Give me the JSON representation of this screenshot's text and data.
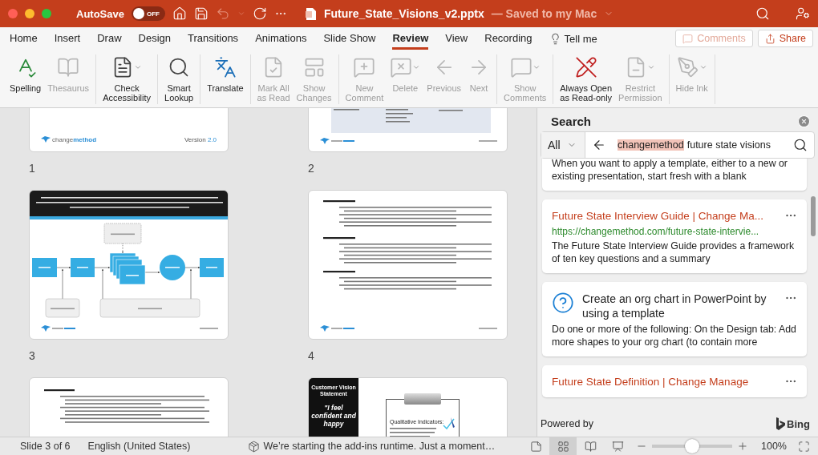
{
  "titlebar": {
    "autosave_label": "AutoSave",
    "autosave": {
      "on": false,
      "label": "OFF"
    },
    "undo": {
      "disabled": true
    },
    "filename": "Future_State_Visions_v2.pptx",
    "save_status": "— Saved to my Mac"
  },
  "tabs": [
    {
      "label": "Home",
      "selected": false
    },
    {
      "label": "Insert",
      "selected": false
    },
    {
      "label": "Draw",
      "selected": false
    },
    {
      "label": "Design",
      "selected": false
    },
    {
      "label": "Transitions",
      "selected": false
    },
    {
      "label": "Animations",
      "selected": false
    },
    {
      "label": "Slide Show",
      "selected": false
    },
    {
      "label": "Review",
      "selected": true
    },
    {
      "label": "View",
      "selected": false
    },
    {
      "label": "Recording",
      "selected": false
    }
  ],
  "tell_me": "Tell me",
  "comments_button": {
    "label": "Comments",
    "disabled": true
  },
  "share_button": {
    "label": "Share"
  },
  "ribbon": {
    "groups": [
      [
        {
          "label": "Spelling",
          "disabled": false,
          "dropdown": false
        },
        {
          "label": "Thesaurus",
          "disabled": true,
          "dropdown": false
        }
      ],
      [
        {
          "label": "Check\nAccessibility",
          "disabled": false,
          "dropdown": true
        }
      ],
      [
        {
          "label": "Smart\nLookup",
          "disabled": false,
          "dropdown": false
        }
      ],
      [
        {
          "label": "Translate",
          "disabled": false,
          "dropdown": false
        }
      ],
      [
        {
          "label": "Mark All\nas Read",
          "disabled": true,
          "dropdown": false
        },
        {
          "label": "Show\nChanges",
          "disabled": true,
          "dropdown": false
        }
      ],
      [
        {
          "label": "New\nComment",
          "disabled": true,
          "dropdown": false
        },
        {
          "label": "Delete",
          "disabled": true,
          "dropdown": true
        },
        {
          "label": "Previous",
          "disabled": true,
          "dropdown": false
        },
        {
          "label": "Next",
          "disabled": true,
          "dropdown": false
        }
      ],
      [
        {
          "label": "Show\nComments",
          "disabled": true,
          "dropdown": true
        }
      ],
      [
        {
          "label": "Always Open\nas Read-only",
          "disabled": false,
          "dropdown": false
        },
        {
          "label": "Restrict\nPermission",
          "disabled": true,
          "dropdown": true
        }
      ],
      [
        {
          "label": "Hide Ink",
          "disabled": true,
          "dropdown": true
        }
      ]
    ]
  },
  "slides": [
    {
      "number": "1",
      "kind": "closing",
      "logo": "change**method**",
      "version": "Version **2.0**"
    },
    {
      "number": "2",
      "kind": "table"
    },
    {
      "number": "3",
      "kind": "diagram",
      "nodes": [
        {
          "kind": "dashed"
        },
        {
          "kind": "box"
        },
        {
          "kind": "box"
        },
        {
          "kind": "stack"
        },
        {
          "kind": "circle"
        },
        {
          "kind": "box"
        },
        {
          "kind": "rounded"
        },
        {
          "kind": "rounded"
        }
      ]
    },
    {
      "number": "4",
      "kind": "steps"
    },
    {
      "kind": "steps"
    },
    {
      "kind": "vision",
      "panel_title": "Customer Vision Statement",
      "quote": "\"I feel confident and happy",
      "board_title": "Qualitative Indicators:"
    }
  ],
  "search": {
    "title": "Search",
    "scope": "All",
    "query": [
      {
        "text": "changemethod",
        "highlighted": true
      },
      {
        "text": "future state visions",
        "highlighted": false
      }
    ],
    "results": [
      {
        "description": "When you want to apply a template, either to a new or existing presentation, start fresh with a blank"
      },
      {
        "kind": "web",
        "title": "Future State Interview Guide | Change Ma...",
        "url": "https://changemethod.com/future-state-intervie...",
        "description": "The Future State Interview Guide provides a framework of ten key questions and a summary"
      },
      {
        "kind": "help",
        "title": "Create an org chart in PowerPoint by using a template",
        "description": "Do one or more of the following: On the Design tab: Add more shapes to your org chart (to contain more"
      },
      {
        "kind": "web",
        "title": "Future State Definition | Change Manage"
      }
    ],
    "powered_by": "Powered by",
    "provider": "Bing"
  },
  "status_bar": {
    "slide": "Slide 3 of 6",
    "language": "English (United States)",
    "message": "We’re starting the add-ins runtime. Just a moment…",
    "views": [
      {
        "kind": "notes",
        "selected": false
      },
      {
        "kind": "sorter",
        "selected": true
      },
      {
        "kind": "reading",
        "selected": false
      },
      {
        "kind": "slideshow",
        "selected": false
      }
    ],
    "zoom": {
      "level": 0.5,
      "value": "100%"
    }
  }
}
